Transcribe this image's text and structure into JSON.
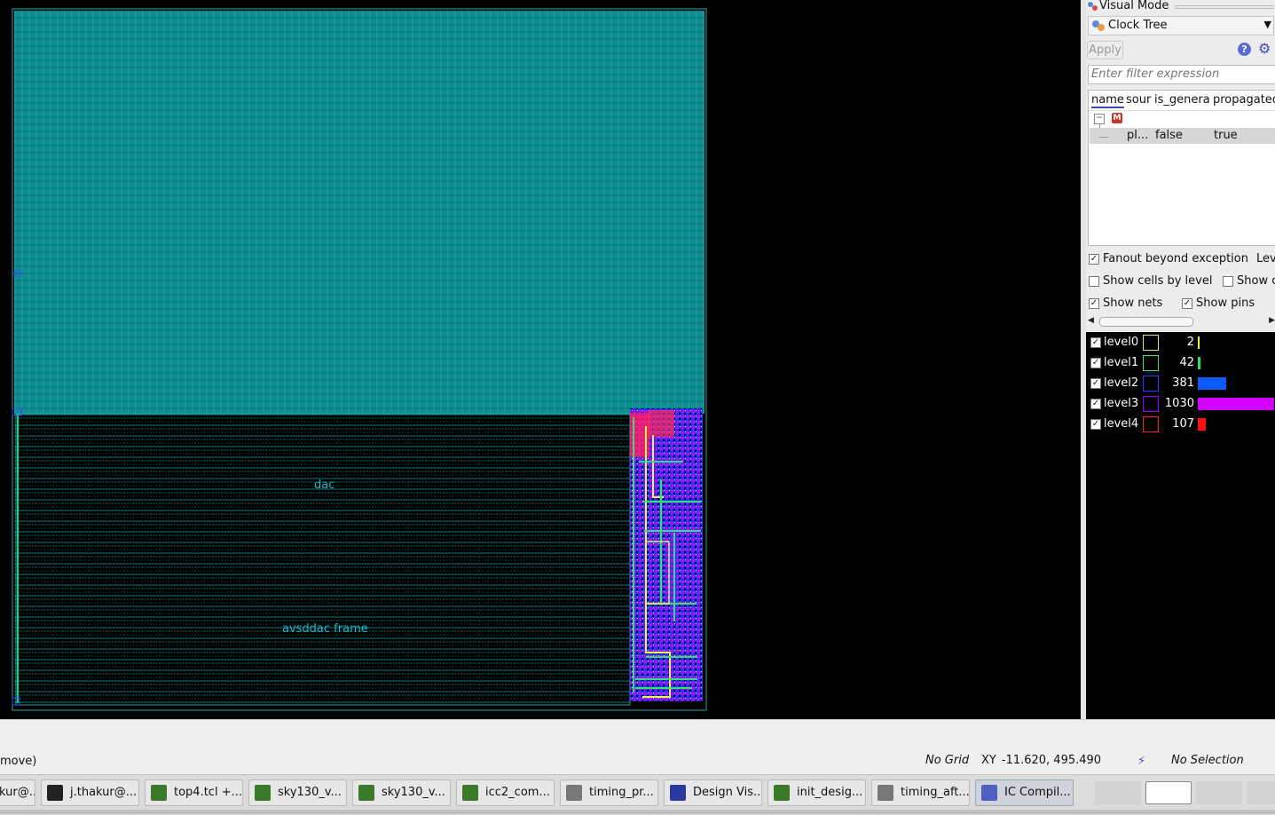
{
  "canvas": {
    "labels": {
      "dac": "dac",
      "frame": "avsddac frame"
    }
  },
  "panel": {
    "title": "Visual Mode",
    "mode_select": "Clock Tree",
    "apply_label": "Apply",
    "help_glyph": "?",
    "filter_placeholder": "Enter filter expression",
    "columns": [
      "name",
      "sour",
      "is_genera",
      "propagated"
    ],
    "root_icon_label": "M",
    "row": {
      "name": "pl...",
      "is_generated": "false",
      "propagated": "true"
    },
    "options": {
      "fanout_beyond_exception": {
        "label": "Fanout beyond exception",
        "checked": true
      },
      "level_trunc": "Lev",
      "show_cells_by_level": {
        "label": "Show cells by level",
        "checked": false
      },
      "show_trunc": {
        "label": "Show c",
        "checked": false
      },
      "show_nets": {
        "label": "Show nets",
        "checked": true
      },
      "show_pins": {
        "label": "Show pins",
        "checked": true
      }
    },
    "levels": [
      {
        "name": "level0",
        "count": "2",
        "color": "#f5f545",
        "swatch": "#d8f060",
        "bar_fraction": 0.0019
      },
      {
        "name": "level1",
        "count": "42",
        "color": "#30e060",
        "swatch": "#40e080",
        "bar_fraction": 0.04
      },
      {
        "name": "level2",
        "count": "381",
        "color": "#0a5cff",
        "swatch": "#2040ff",
        "bar_fraction": 0.37
      },
      {
        "name": "level3",
        "count": "1030",
        "color": "#d400ff",
        "swatch": "#9900ff",
        "bar_fraction": 1.0
      },
      {
        "name": "level4",
        "count": "107",
        "color": "#ff1010",
        "swatch": "#ff2020",
        "bar_fraction": 0.104
      }
    ]
  },
  "status": {
    "left": "move)",
    "grid": "No Grid",
    "xy_label": "XY",
    "xy": "-11.620, 495.490",
    "selection": "No Selection"
  },
  "taskbar": [
    {
      "label": "kur@...",
      "icon": "terminal-icon"
    },
    {
      "label": "j.thakur@...",
      "icon": "terminal-icon"
    },
    {
      "label": "top4.tcl +...",
      "icon": "editor-icon"
    },
    {
      "label": "sky130_v...",
      "icon": "editor-icon"
    },
    {
      "label": "sky130_v...",
      "icon": "editor-icon"
    },
    {
      "label": "icc2_com...",
      "icon": "editor-icon"
    },
    {
      "label": "timing_pr...",
      "icon": "magnifier-icon"
    },
    {
      "label": "Design Vis...",
      "icon": "dv-icon"
    },
    {
      "label": "init_desig...",
      "icon": "editor-icon"
    },
    {
      "label": "timing_aft...",
      "icon": "magnifier-icon"
    },
    {
      "label": "IC Compil...",
      "icon": "icc-icon",
      "active": true
    }
  ]
}
